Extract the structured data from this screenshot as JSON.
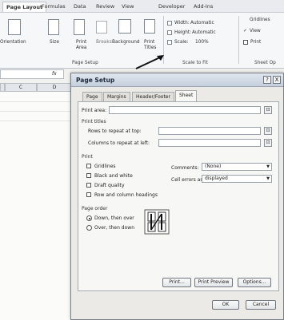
{
  "ribbon": {
    "tabs": [
      "Page Layout",
      "Formulas",
      "Data",
      "Review",
      "View",
      "Developer",
      "Add-Ins"
    ],
    "active_tab": "Page Layout",
    "buttons": {
      "orientation": "Orientation",
      "size": "Size",
      "print_area_1": "Print",
      "print_area_2": "Area",
      "breaks": "Breaks",
      "background": "Background",
      "print_titles_1": "Print",
      "print_titles_2": "Titles"
    },
    "page_setup_group": "Page Setup",
    "scale_to_fit": {
      "width_label": "Width:",
      "width_value": "Automatic",
      "height_label": "Height:",
      "height_value": "Automatic",
      "scale_label": "Scale:",
      "scale_value": "100%",
      "group_label": "Scale to Fit"
    },
    "sheet_options": {
      "gridlines": "Gridlines",
      "view": "View",
      "print": "Print",
      "group_label": "Sheet Op"
    }
  },
  "sheet": {
    "col_c": "C",
    "col_d": "D",
    "fx": "fx"
  },
  "dialog": {
    "title": "Page Setup",
    "help": "?",
    "close": "X",
    "tabs": [
      "Page",
      "Margins",
      "Header/Footer",
      "Sheet"
    ],
    "selected_tab": "Sheet",
    "print_area_label": "Print area:",
    "print_titles_section": "Print titles",
    "rows_repeat_label": "Rows to repeat at top:",
    "cols_repeat_label": "Columns to repeat at left:",
    "print_section": "Print",
    "checkboxes": [
      "Gridlines",
      "Black and white",
      "Draft quality",
      "Row and column headings"
    ],
    "comments_label": "Comments:",
    "comments_value": "(None)",
    "cell_errors_label": "Cell errors as:",
    "cell_errors_value": "displayed",
    "page_order_section": "Page order",
    "order_options": [
      "Down, then over",
      "Over, then down"
    ],
    "selected_order": "Down, then over",
    "buttons": {
      "print": "Print...",
      "print_preview": "Print Preview",
      "options": "Options...",
      "ok": "OK",
      "cancel": "Cancel"
    }
  }
}
